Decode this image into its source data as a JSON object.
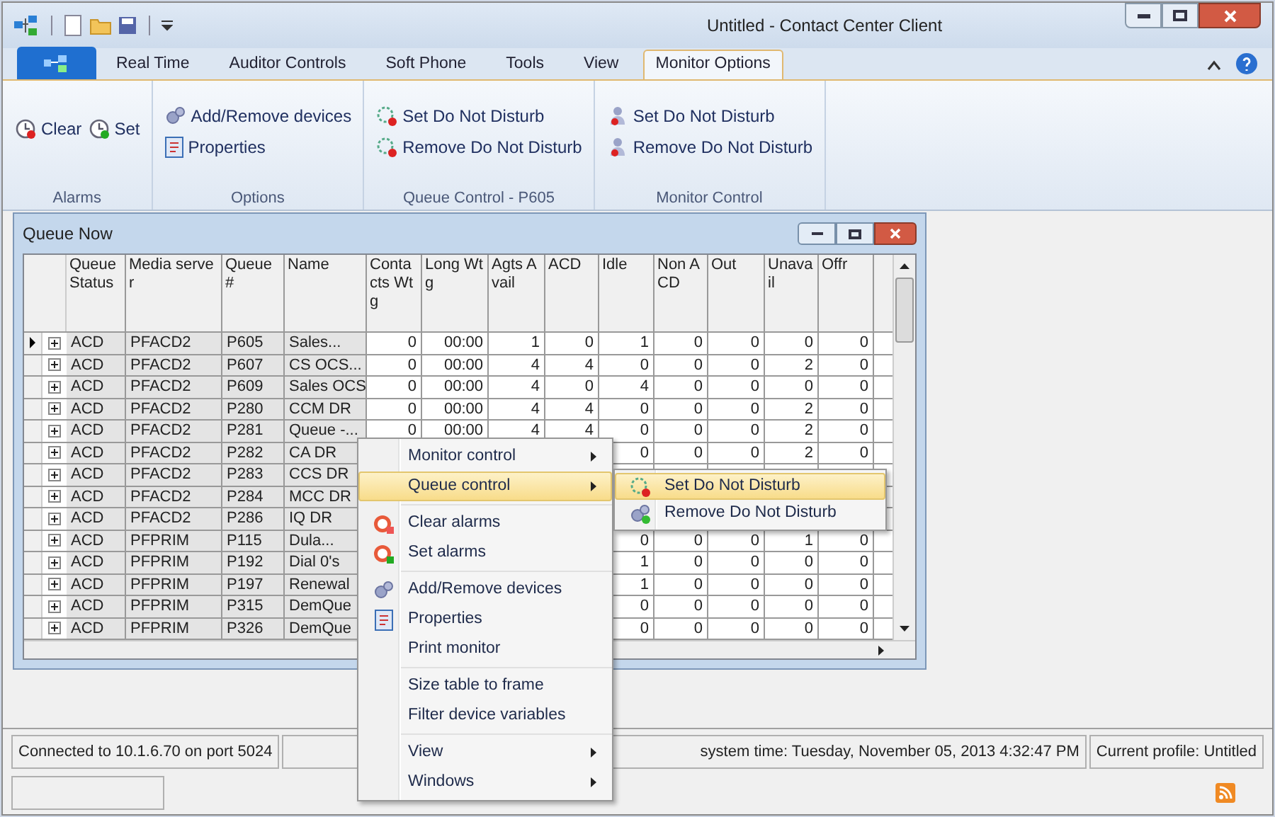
{
  "window": {
    "title": "Untitled - Contact Center Client"
  },
  "tabs": [
    {
      "label": "Real Time",
      "selected": false
    },
    {
      "label": "Auditor Controls",
      "selected": false
    },
    {
      "label": "Soft Phone",
      "selected": false
    },
    {
      "label": "Tools",
      "selected": false
    },
    {
      "label": "View",
      "selected": false
    },
    {
      "label": "Monitor Options",
      "selected": true
    }
  ],
  "ribbon": [
    {
      "label": "Alarms",
      "items": [
        {
          "label": "Clear",
          "kind": "alarm-clear"
        },
        {
          "label": "Set",
          "kind": "alarm-set"
        }
      ]
    },
    {
      "label": "Options",
      "items": [
        {
          "label": "Add/Remove devices",
          "kind": "gears"
        },
        {
          "label": "Properties",
          "kind": "properties"
        }
      ]
    },
    {
      "label": "Queue Control - P605",
      "items": [
        {
          "label": "Set Do Not Disturb",
          "kind": "dnd-set"
        },
        {
          "label": "Remove Do Not Disturb",
          "kind": "dnd-remove"
        }
      ]
    },
    {
      "label": "Monitor Control",
      "items": [
        {
          "label": "Set Do Not Disturb",
          "kind": "person-set"
        },
        {
          "label": "Remove Do Not Disturb",
          "kind": "person-remove"
        }
      ]
    }
  ],
  "queue_window": {
    "title": "Queue Now",
    "columns": [
      "Queue Status",
      "Media server",
      "Queue #",
      "Name",
      "Contacts Wtg",
      "Long Wtg",
      "Agts Avail",
      "ACD",
      "Idle",
      "Non ACD",
      "Out",
      "Unavail",
      "Offr"
    ],
    "rows": [
      {
        "selected": true,
        "cells": [
          "ACD",
          "PFACD2",
          "P605",
          "Sales...",
          "0",
          "00:00",
          "1",
          "0",
          "1",
          "0",
          "0",
          "0",
          "0"
        ]
      },
      {
        "selected": false,
        "cells": [
          "ACD",
          "PFACD2",
          "P607",
          "CS OCS...",
          "0",
          "00:00",
          "4",
          "4",
          "0",
          "0",
          "0",
          "2",
          "0"
        ]
      },
      {
        "selected": false,
        "cells": [
          "ACD",
          "PFACD2",
          "P609",
          "Sales OCS",
          "0",
          "00:00",
          "4",
          "0",
          "4",
          "0",
          "0",
          "0",
          "0"
        ]
      },
      {
        "selected": false,
        "cells": [
          "ACD",
          "PFACD2",
          "P280",
          "CCM DR",
          "0",
          "00:00",
          "4",
          "4",
          "0",
          "0",
          "0",
          "2",
          "0"
        ]
      },
      {
        "selected": false,
        "cells": [
          "ACD",
          "PFACD2",
          "P281",
          "Queue -...",
          "0",
          "00:00",
          "4",
          "4",
          "0",
          "0",
          "0",
          "2",
          "0"
        ]
      },
      {
        "selected": false,
        "cells": [
          "ACD",
          "PFACD2",
          "P282",
          "CA DR",
          null,
          null,
          null,
          null,
          "0",
          "0",
          "0",
          "2",
          "0"
        ]
      },
      {
        "selected": false,
        "cells": [
          "ACD",
          "PFACD2",
          "P283",
          "CCS DR",
          null,
          null,
          null,
          null,
          null,
          null,
          null,
          null,
          null
        ]
      },
      {
        "selected": false,
        "cells": [
          "ACD",
          "PFACD2",
          "P284",
          "MCC DR",
          null,
          null,
          null,
          null,
          null,
          null,
          null,
          null,
          null
        ]
      },
      {
        "selected": false,
        "cells": [
          "ACD",
          "PFACD2",
          "P286",
          "IQ DR",
          null,
          null,
          null,
          null,
          null,
          null,
          null,
          null,
          null
        ]
      },
      {
        "selected": false,
        "cells": [
          "ACD",
          "PFPRIM",
          "P115",
          "Dula...",
          null,
          null,
          null,
          null,
          "0",
          "0",
          "0",
          "1",
          "0"
        ]
      },
      {
        "selected": false,
        "cells": [
          "ACD",
          "PFPRIM",
          "P192",
          "Dial 0's",
          null,
          null,
          null,
          null,
          "1",
          "0",
          "0",
          "0",
          "0"
        ]
      },
      {
        "selected": false,
        "cells": [
          "ACD",
          "PFPRIM",
          "P197",
          "Renewal",
          null,
          null,
          null,
          null,
          "1",
          "0",
          "0",
          "0",
          "0"
        ]
      },
      {
        "selected": false,
        "cells": [
          "ACD",
          "PFPRIM",
          "P315",
          "DemQue",
          null,
          null,
          null,
          null,
          "0",
          "0",
          "0",
          "0",
          "0"
        ]
      },
      {
        "selected": false,
        "cells": [
          "ACD",
          "PFPRIM",
          "P326",
          "DemQue",
          null,
          null,
          null,
          null,
          "0",
          "0",
          "0",
          "0",
          "0"
        ]
      }
    ]
  },
  "context_menu": {
    "sections": [
      [
        {
          "label": "Monitor control",
          "kind": "plain",
          "submenu": true,
          "selected": false
        },
        {
          "label": "Queue control",
          "kind": "plain",
          "submenu": true,
          "selected": true
        }
      ],
      [
        {
          "label": "Clear alarms",
          "kind": "alarm-clear",
          "submenu": false,
          "selected": false
        },
        {
          "label": "Set alarms",
          "kind": "alarm-set",
          "submenu": false,
          "selected": false
        }
      ],
      [
        {
          "label": "Add/Remove devices",
          "kind": "gears",
          "submenu": false,
          "selected": false
        },
        {
          "label": "Properties",
          "kind": "properties",
          "submenu": false,
          "selected": false
        },
        {
          "label": "Print monitor",
          "kind": "plain",
          "submenu": false,
          "selected": false
        }
      ],
      [
        {
          "label": "Size table to frame",
          "kind": "plain",
          "submenu": false,
          "selected": false
        },
        {
          "label": "Filter device variables",
          "kind": "plain",
          "submenu": false,
          "selected": false
        }
      ],
      [
        {
          "label": "View",
          "kind": "plain",
          "submenu": true,
          "selected": false
        },
        {
          "label": "Windows",
          "kind": "plain",
          "submenu": true,
          "selected": false
        }
      ]
    ]
  },
  "submenu": [
    {
      "label": "Set Do Not Disturb",
      "kind": "dnd-set",
      "selected": true
    },
    {
      "label": "Remove Do Not Disturb",
      "kind": "gears-add",
      "selected": false
    }
  ],
  "status_bar": {
    "connection": "Connected to 10.1.6.70 on port 5024",
    "system_time": "system time: Tuesday, November 05, 2013 4:32:47 PM",
    "profile": "Current profile: Untitled"
  }
}
